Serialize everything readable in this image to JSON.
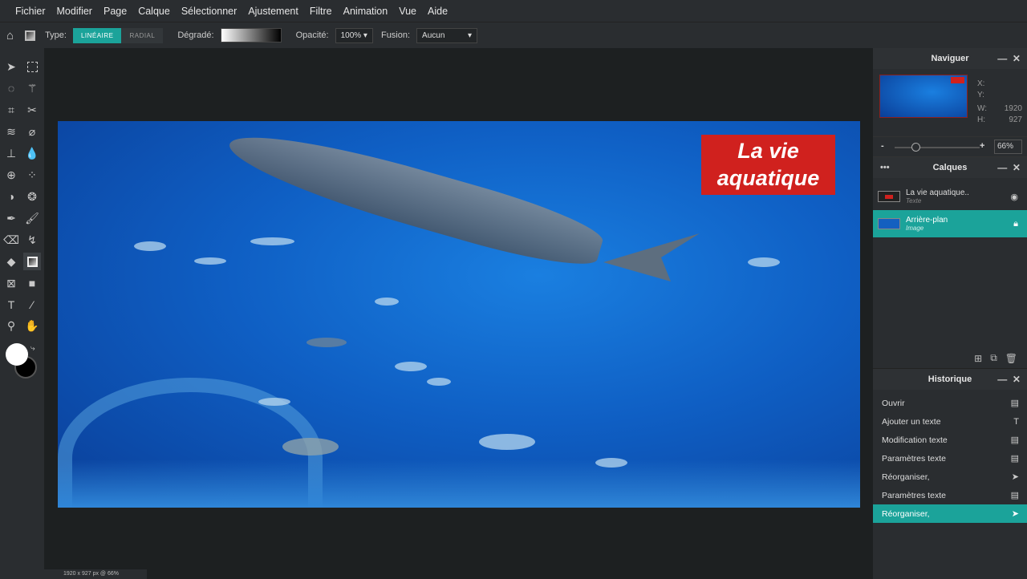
{
  "menu": [
    "Fichier",
    "Modifier",
    "Page",
    "Calque",
    "Sélectionner",
    "Ajustement",
    "Filtre",
    "Animation",
    "Vue",
    "Aide"
  ],
  "toolbar": {
    "type_label": "Type:",
    "linear": "LINÉAIRE",
    "radial": "RADIAL",
    "gradient_label": "Dégradé:",
    "opacity_label": "Opacité:",
    "opacity_value": "100%",
    "blend_label": "Fusion:",
    "blend_value": "Aucun"
  },
  "tools": [
    "select-arrow",
    "marquee",
    "lasso",
    "magic-wand",
    "crop",
    "scissors",
    "liquify",
    "bandage",
    "stamp",
    "blur-drop",
    "sphere",
    "pattern",
    "dodge",
    "sponge",
    "eyedropper",
    "brush",
    "eraser",
    "smudge",
    "paint-bucket",
    "gradient",
    "frame",
    "shape",
    "text",
    "color-picker",
    "zoom",
    "hand"
  ],
  "image": {
    "title_line1": "La vie",
    "title_line2": "aquatique"
  },
  "status": "1920 x 927 px @ 66%",
  "navigator": {
    "title": "Naviguer",
    "x_label": "X:",
    "y_label": "Y:",
    "w_label": "W:",
    "w_value": "1920",
    "h_label": "H:",
    "h_value": "927",
    "zoom": "66%",
    "zoom_fraction": 0.2,
    "minus": "-",
    "plus": "+"
  },
  "layers": {
    "title": "Calques",
    "items": [
      {
        "name": "La vie aquatique..",
        "type": "Texte"
      },
      {
        "name": "Arrière-plan",
        "type": "Image"
      }
    ]
  },
  "history": {
    "title": "Historique",
    "items": [
      "Ouvrir",
      "Ajouter un texte",
      "Modification texte",
      "Paramètres texte",
      "Réorganiser,",
      "Paramètres texte",
      "Réorganiser,"
    ]
  },
  "colors": {
    "accent": "#1ba39a",
    "title_bg": "#d0211e"
  }
}
